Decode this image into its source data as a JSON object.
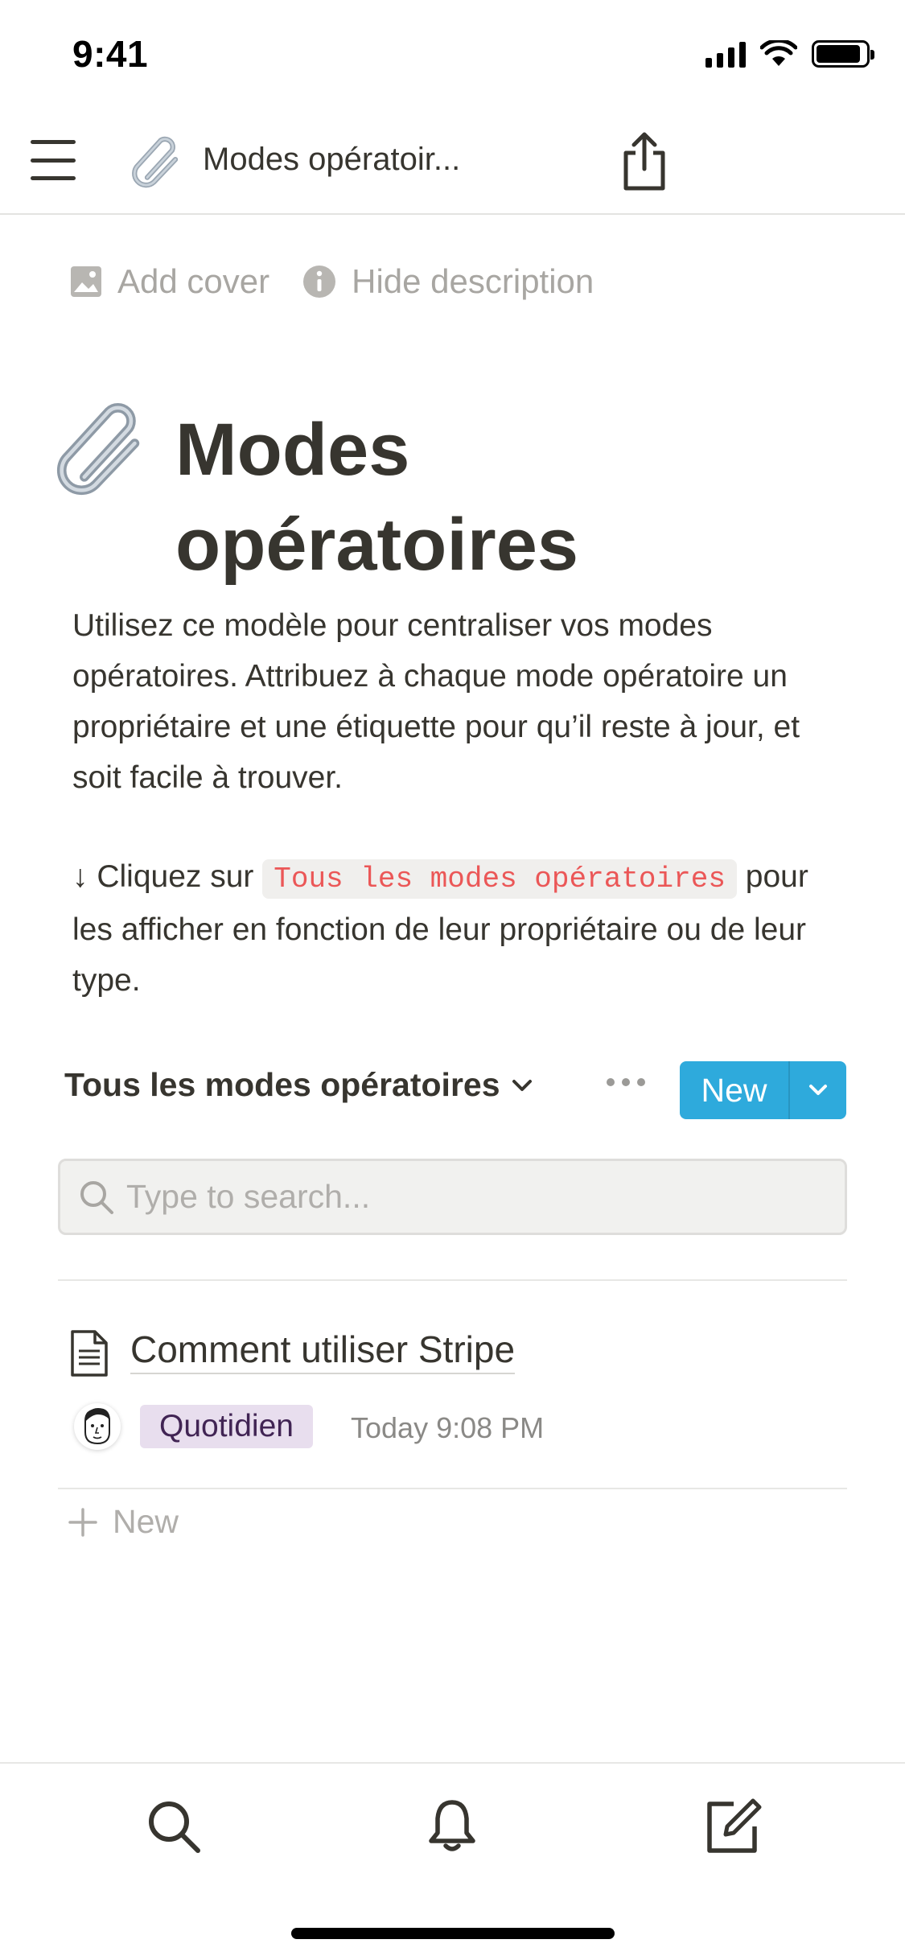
{
  "status_bar": {
    "time": "9:41",
    "battery_level": 0.9
  },
  "nav": {
    "page_icon": "paperclip-icon",
    "title": "Modes opératoir..."
  },
  "page_actions": {
    "add_cover": "Add cover",
    "hide_description": "Hide description"
  },
  "page": {
    "icon": "paperclip-icon",
    "title_line1": "Modes",
    "title_line2": "opératoires",
    "description": "Utilisez ce modèle pour centraliser vos modes opératoires. Attribuez à chaque mode opératoire un propriétaire et une étiquette pour qu’il reste à jour, et soit facile à trouver.",
    "hint_prefix": "↓ Cliquez sur ",
    "hint_code": "Tous les modes opératoires",
    "hint_suffix": " pour les afficher en fonction de leur propriétaire ou de leur type."
  },
  "database": {
    "view_name": "Tous les modes opératoires",
    "new_label": "New",
    "search_placeholder": "Type to search...",
    "items": [
      {
        "title": "Comment utiliser Stripe",
        "tag": "Quotidien",
        "tag_color": "#e8deee",
        "timestamp": "Today 9:08 PM"
      }
    ],
    "add_new_label": "New"
  },
  "colors": {
    "accent": "#2eaadc",
    "code_text": "#eb5757",
    "text": "#37352f",
    "muted": "#a8a6a2"
  },
  "tab_bar": {
    "items": [
      "search-icon",
      "bell-icon",
      "compose-icon"
    ]
  }
}
